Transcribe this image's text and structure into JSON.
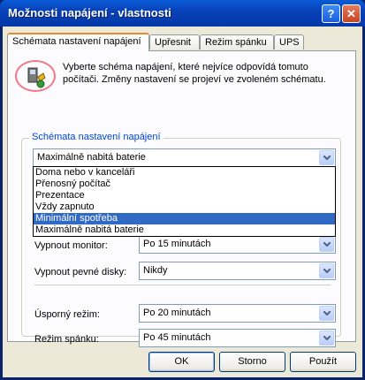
{
  "window": {
    "title": "Možnosti napájení - vlastnosti",
    "help_glyph": "?",
    "close_glyph": "✕"
  },
  "tabs": [
    {
      "label": "Schémata nastavení napájení"
    },
    {
      "label": "Upřesnit"
    },
    {
      "label": "Režim spánku"
    },
    {
      "label": "UPS"
    }
  ],
  "intro": {
    "icon": "power-scheme-icon",
    "text": "Vyberte schéma napájení, které nejvíce odpovídá tomuto počítači. Změny nastavení se projeví ve zvoleném schématu."
  },
  "scheme_group": {
    "label": "Schémata nastavení napájení",
    "selected": "Maximálně nabitá baterie",
    "options": [
      "Doma nebo v kanceláři",
      "Přenosný počítač",
      "Prezentace",
      "Vždy zapnuto",
      "Minimální spotřeba",
      "Maximálně nabitá baterie"
    ],
    "highlighted_option": "Minimální spotřeba"
  },
  "settings": [
    {
      "label": "Vypnout monitor:",
      "value": "Po 15 minutách"
    },
    {
      "label": "Vypnout pevné disky:",
      "value": "Nikdy"
    },
    {
      "label": "Úsporný režim:",
      "value": "Po 20 minutách"
    },
    {
      "label": "Režim spánku:",
      "value": "Po 45 minutách"
    }
  ],
  "buttons": {
    "ok": "OK",
    "cancel": "Storno",
    "apply": "Použít"
  },
  "colors": {
    "titlebar": "#0842b8",
    "selection": "#316ac5",
    "group_label": "#0046d5"
  }
}
